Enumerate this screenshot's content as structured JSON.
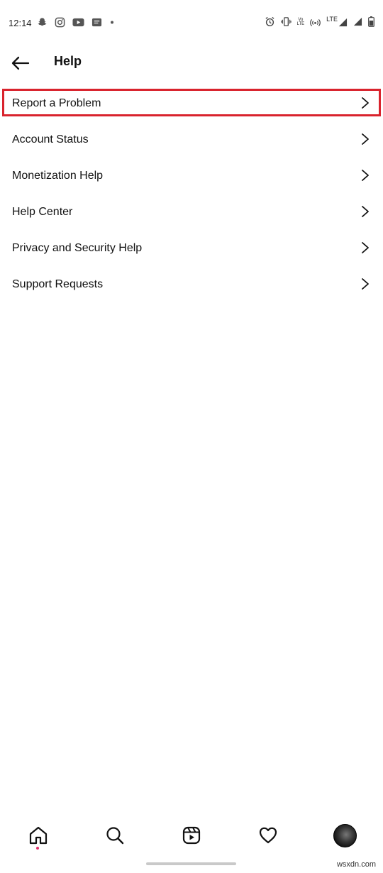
{
  "status_bar": {
    "time": "12:14",
    "network_type": "LTE",
    "volte_label_top": "Vo",
    "volte_label_bottom": "LTE",
    "icons": [
      "snapchat-icon",
      "instagram-icon",
      "youtube-icon",
      "app-icon",
      "dot-icon",
      "alarm-icon",
      "vibrate-icon",
      "volte-icon",
      "hotspot-icon",
      "signal-icon",
      "signal-icon",
      "battery-icon"
    ]
  },
  "header": {
    "title": "Help",
    "back_icon": "back-arrow-icon"
  },
  "menu": {
    "items": [
      {
        "label": "Report a Problem",
        "highlighted": true
      },
      {
        "label": "Account Status"
      },
      {
        "label": "Monetization Help"
      },
      {
        "label": "Help Center"
      },
      {
        "label": "Privacy and Security Help"
      },
      {
        "label": "Support Requests"
      }
    ],
    "chevron_icon": "chevron-right-icon"
  },
  "bottom_nav": {
    "items": [
      "home-icon",
      "search-icon",
      "reels-icon",
      "heart-icon",
      "profile-avatar"
    ],
    "active": "home-icon"
  },
  "watermark": "wsxdn.com",
  "colors": {
    "highlight": "#d9232d",
    "notification_dot": "#e1306c",
    "home_indicator": "#c9c9c9",
    "text": "#111111",
    "background": "#ffffff"
  }
}
